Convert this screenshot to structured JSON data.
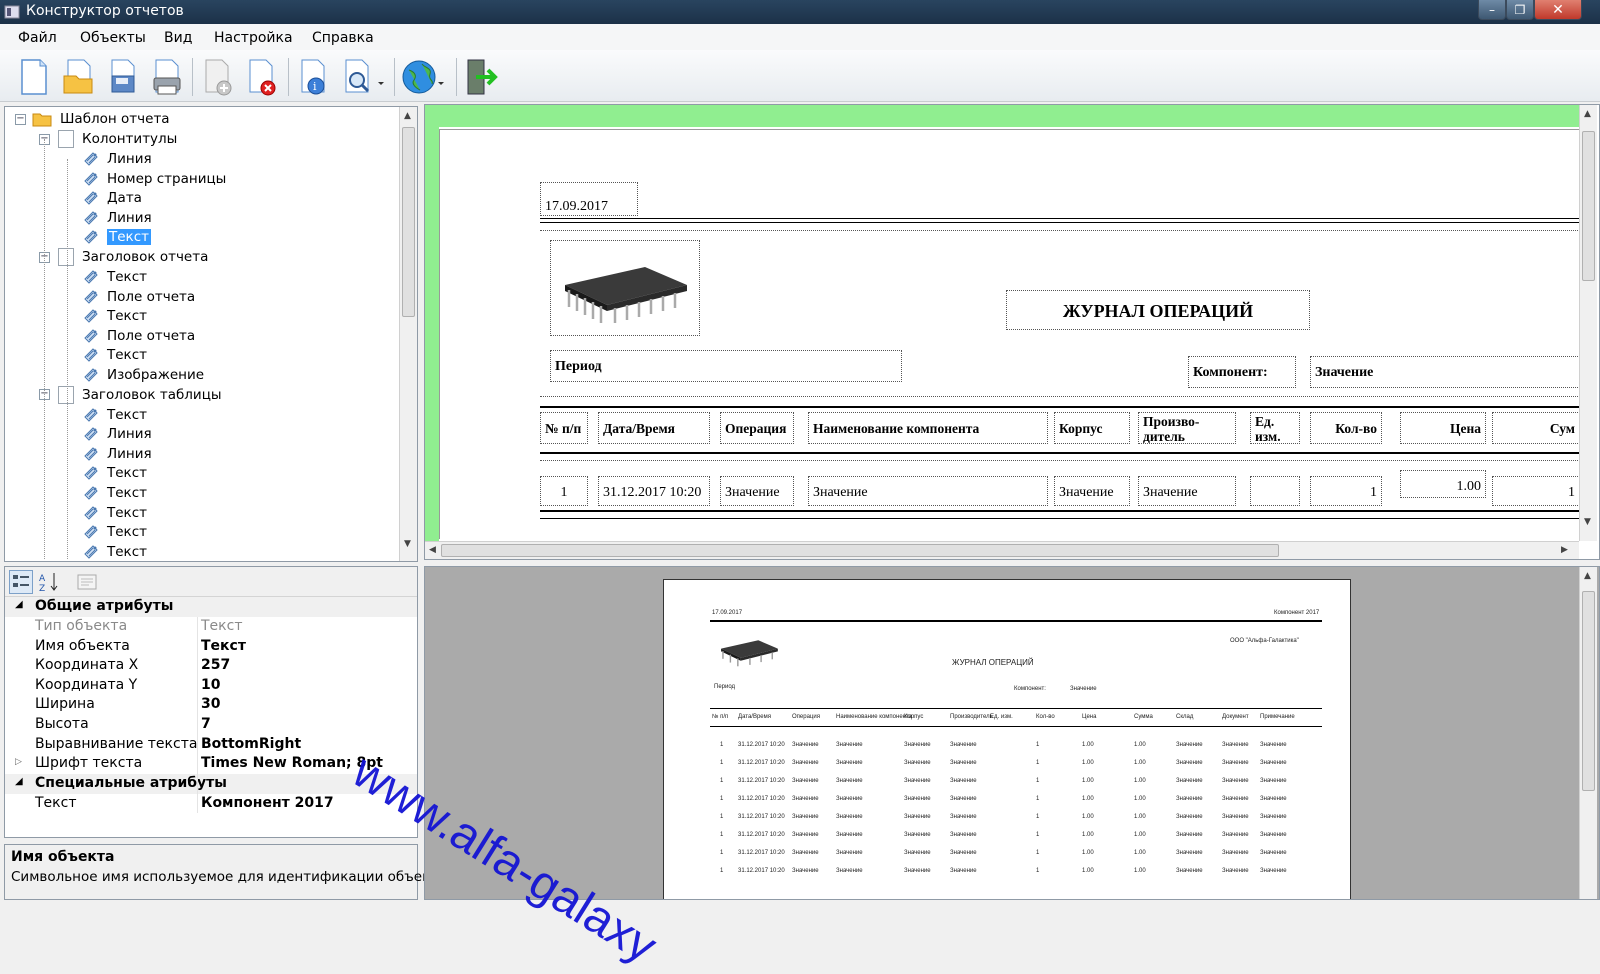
{
  "window": {
    "title": "Конструктор отчетов",
    "minimize": "–",
    "maximize": "❐",
    "close": "✕"
  },
  "menu": [
    "Файл",
    "Объекты",
    "Вид",
    "Настройка",
    "Справка"
  ],
  "toolbar": {
    "buttons": [
      "new-document-icon",
      "open-folder-icon",
      "save-icon",
      "print-icon",
      "add-object-icon",
      "delete-object-icon",
      "info-icon",
      "zoom-icon",
      "globe-icon",
      "exit-icon"
    ]
  },
  "tree": {
    "root": "Шаблон отчета",
    "groups": [
      {
        "label": "Колонтитулы",
        "items": [
          "Линия",
          "Номер страницы",
          "Дата",
          "Линия",
          "Текст"
        ]
      },
      {
        "label": "Заголовок отчета",
        "items": [
          "Текст",
          "Поле отчета",
          "Текст",
          "Поле отчета",
          "Текст",
          "Изображение"
        ]
      },
      {
        "label": "Заголовок таблицы",
        "items": [
          "Текст",
          "Линия",
          "Линия",
          "Текст",
          "Текст",
          "Текст",
          "Текст",
          "Текст"
        ]
      }
    ],
    "selected": "Текст"
  },
  "props": {
    "categories": {
      "general": "Общие атрибуты",
      "special": "Специальные атрибуты"
    },
    "rows": [
      {
        "name": "Тип объекта",
        "value": "Текст",
        "readonly": true
      },
      {
        "name": "Имя объекта",
        "value": "Текст"
      },
      {
        "name": "Координата X",
        "value": "257"
      },
      {
        "name": "Координата Y",
        "value": "10"
      },
      {
        "name": "Ширина",
        "value": "30"
      },
      {
        "name": "Высота",
        "value": "7"
      },
      {
        "name": "Выравнивание текста",
        "value": "BottomRight"
      },
      {
        "name": "Шрифт текста",
        "value": "Times New Roman; 8pt"
      }
    ],
    "special_rows": [
      {
        "name": "Текст",
        "value": "Компонент 2017"
      }
    ],
    "desc_title": "Имя объекта",
    "desc_text": "Символьное имя используемое для идентификации объекта"
  },
  "design": {
    "date": "17.09.2017",
    "title": "ЖУРНАЛ ОПЕРАЦИЙ",
    "period": "Период",
    "component_label": "Компонент:",
    "component_value": "Значение",
    "headers": [
      "№ п/п",
      "Дата/Время",
      "Операция",
      "Наименование компонента",
      "Корпус",
      "Произво-дитель",
      "Ед. изм.",
      "Кол-во",
      "Цена",
      "Сум"
    ],
    "row": [
      "1",
      "31.12.2017 10:20",
      "Значение",
      "Значение",
      "Значение",
      "Значение",
      "",
      "1",
      "1.00",
      "1"
    ]
  },
  "preview": {
    "date": "17.09.2017",
    "header_right": "Компонент 2017",
    "company": "ООО \"Альфа-Галактика\"",
    "title": "ЖУРНАЛ ОПЕРАЦИЙ",
    "period": "Период",
    "component_label": "Компонент:",
    "component_value": "Значение",
    "headers": [
      "№ п/п",
      "Дата/Время",
      "Операция",
      "Наименование компонента",
      "Корпус",
      "Производитель",
      "Ед. изм.",
      "Кол-во",
      "Цена",
      "Сумма",
      "Склад",
      "Документ",
      "Примечание"
    ],
    "row": [
      "1",
      "31.12.2017 10:20",
      "Значение",
      "Значение",
      "Значение",
      "Значение",
      "",
      "1",
      "1.00",
      "1.00",
      "Значение",
      "Значение",
      "Значение"
    ],
    "watermark": "www.alfa-galaxy"
  }
}
